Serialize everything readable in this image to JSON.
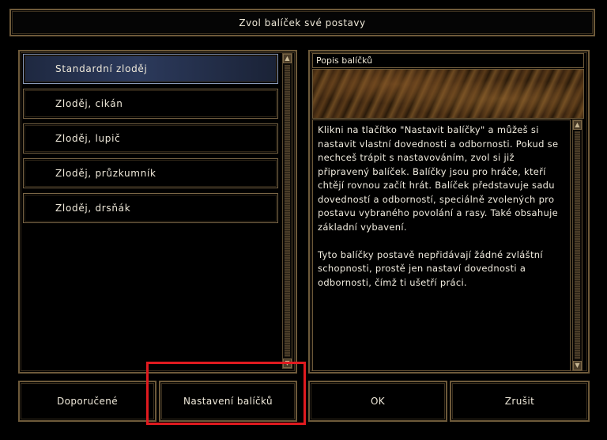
{
  "title": "Zvol balíček své postavy",
  "list": {
    "items": [
      {
        "label": "Standardní zloděj",
        "selected": true
      },
      {
        "label": "Zloděj, cikán",
        "selected": false
      },
      {
        "label": "Zloděj, lupič",
        "selected": false
      },
      {
        "label": "Zloděj, průzkumník",
        "selected": false
      },
      {
        "label": "Zloděj, drsňák",
        "selected": false
      }
    ]
  },
  "description": {
    "header": "Popis balíčků",
    "paragraph1": "Klikni na tlačítko \"Nastavit balíčky\" a můžeš si nastavit vlastní dovednosti a odbornosti. Pokud se nechceš trápit s nastavováním, zvol si již připravený balíček. Balíčky jsou pro hráče, kteří chtějí rovnou začít hrát. Balíček představuje sadu dovedností a odborností, speciálně zvolených pro postavu vybraného povolání a rasy. Také obsahuje základní vybavení.",
    "paragraph2": "Tyto balíčky postavě nepřidávají žádné zvláštní schopnosti, prostě jen nastaví dovednosti a odbornosti, čímž ti ušetří práci."
  },
  "buttons": {
    "recommended": "Doporučené",
    "package_settings": "Nastavení balíčků",
    "ok": "OK",
    "cancel": "Zrušit"
  },
  "icons": {
    "scroll_up": "arrow-up-icon",
    "scroll_down": "arrow-down-icon"
  },
  "colors": {
    "border": "#6e5a3a",
    "selected": "#2c3a5c",
    "highlight": "#e01a1f"
  }
}
